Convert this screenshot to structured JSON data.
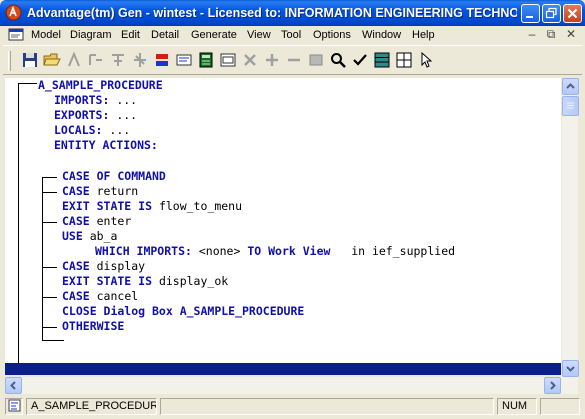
{
  "window": {
    "title": "Advantage(tm) Gen - wintest - Licensed to:  INFORMATION ENGINEERING TECHNOLOG..."
  },
  "menu": {
    "items": [
      "Model",
      "Diagram",
      "Edit",
      "Detail",
      "Generate",
      "View",
      "Tool",
      "Options",
      "Window",
      "Help"
    ]
  },
  "toolbar": {
    "icons": [
      "save-icon",
      "open-folder-icon",
      "add-action-icon",
      "add-statement-icon",
      "add-subtree-icon",
      "add-node-icon",
      "color-icon",
      "comment-icon",
      "calculator-icon",
      "view-icon",
      "delete-icon",
      "plus-icon",
      "minus-icon",
      "box-icon",
      "find-icon",
      "check-icon",
      "grid-icon",
      "window-icon",
      "cursor-icon"
    ]
  },
  "code": {
    "lines": [
      [
        {
          "t": "A_SAMPLE_PROCEDURE",
          "k": true
        }
      ],
      [
        {
          "t": "IMPORTS:",
          "k": true
        },
        {
          "t": " ...",
          "k": false
        }
      ],
      [
        {
          "t": "EXPORTS:",
          "k": true
        },
        {
          "t": " ...",
          "k": false
        }
      ],
      [
        {
          "t": "LOCALS:",
          "k": true
        },
        {
          "t": " ...",
          "k": false
        }
      ],
      [
        {
          "t": "ENTITY ACTIONS:",
          "k": true
        }
      ],
      [
        {
          "t": "CASE OF COMMAND",
          "k": true
        }
      ],
      [
        {
          "t": "CASE",
          "k": true
        },
        {
          "t": " return",
          "k": false
        }
      ],
      [
        {
          "t": "EXIT STATE IS",
          "k": true
        },
        {
          "t": " flow_to_menu",
          "k": false
        }
      ],
      [
        {
          "t": "CASE",
          "k": true
        },
        {
          "t": " enter",
          "k": false
        }
      ],
      [
        {
          "t": "USE",
          "k": true
        },
        {
          "t": " ab_a",
          "k": false
        }
      ],
      [
        {
          "t": "WHICH IMPORTS:",
          "k": true
        },
        {
          "t": " <none> ",
          "k": false
        },
        {
          "t": "TO Work View",
          "k": true
        },
        {
          "t": "   in ief_supplied",
          "k": false
        }
      ],
      [
        {
          "t": "CASE",
          "k": true
        },
        {
          "t": " display",
          "k": false
        }
      ],
      [
        {
          "t": "EXIT STATE IS",
          "k": true
        },
        {
          "t": " display_ok",
          "k": false
        }
      ],
      [
        {
          "t": "CASE",
          "k": true
        },
        {
          "t": " cancel",
          "k": false
        }
      ],
      [
        {
          "t": "CLOSE Dialog Box A_SAMPLE_PROCEDURE",
          "k": true
        }
      ],
      [
        {
          "t": "OTHERWISE",
          "k": true
        }
      ]
    ]
  },
  "status": {
    "procedure": "A_SAMPLE_PROCEDUR",
    "num": "NUM"
  }
}
